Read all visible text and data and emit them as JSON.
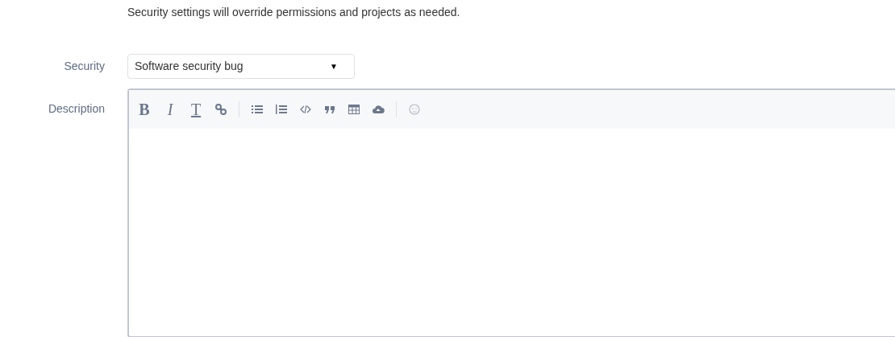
{
  "notice": "Security settings will override permissions and projects as needed.",
  "security": {
    "label": "Security",
    "value": "Software security bug",
    "caret": "▼"
  },
  "description": {
    "label": "Description",
    "toolbar": [
      {
        "kind": "bold",
        "text": "B"
      },
      {
        "kind": "italic",
        "text": "I"
      },
      {
        "kind": "clear",
        "text": "T"
      },
      {
        "kind": "link"
      },
      {
        "kind": "separator"
      },
      {
        "kind": "bullets"
      },
      {
        "kind": "numbers"
      },
      {
        "kind": "code"
      },
      {
        "kind": "quote"
      },
      {
        "kind": "table"
      },
      {
        "kind": "upload"
      },
      {
        "kind": "separator"
      },
      {
        "kind": "emoji"
      }
    ]
  }
}
